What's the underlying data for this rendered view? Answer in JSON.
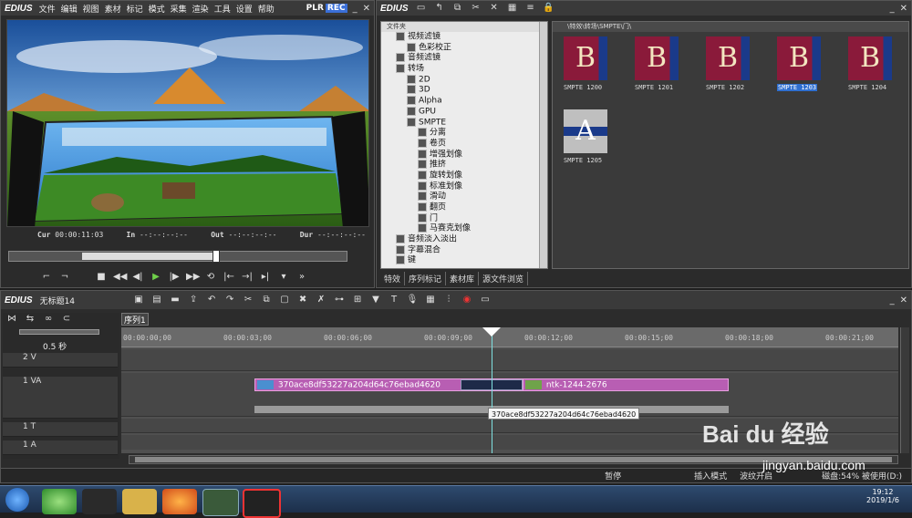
{
  "player": {
    "logo": "EDIUS",
    "menu": [
      "文件",
      "编辑",
      "视图",
      "素材",
      "标记",
      "模式",
      "采集",
      "渲染",
      "工具",
      "设置",
      "帮助"
    ],
    "plr": "PLR",
    "rec": "REC",
    "timecodes": [
      {
        "label": "Cur",
        "value": "00:00:11:03"
      },
      {
        "label": "In",
        "value": "--:--:--:--"
      },
      {
        "label": "Out",
        "value": "--:--:--:--"
      },
      {
        "label": "Dur",
        "value": "--:--:--:--"
      }
    ],
    "position": 0.61
  },
  "bin": {
    "logo": "EDIUS",
    "folder_header": "文件夹",
    "path": "\\特效\\转场\\SMPTE\\门\\",
    "tree": [
      {
        "label": "视频滤镜",
        "indent": 1
      },
      {
        "label": "色彩校正",
        "indent": 2
      },
      {
        "label": "音频滤镜",
        "indent": 1
      },
      {
        "label": "转场",
        "indent": 1
      },
      {
        "label": "2D",
        "indent": 2
      },
      {
        "label": "3D",
        "indent": 2
      },
      {
        "label": "Alpha",
        "indent": 2
      },
      {
        "label": "GPU",
        "indent": 2
      },
      {
        "label": "SMPTE",
        "indent": 2
      },
      {
        "label": "分离",
        "indent": 3
      },
      {
        "label": "卷页",
        "indent": 3
      },
      {
        "label": "增强划像",
        "indent": 3
      },
      {
        "label": "推挤",
        "indent": 3
      },
      {
        "label": "旋转划像",
        "indent": 3
      },
      {
        "label": "标准划像",
        "indent": 3
      },
      {
        "label": "滑动",
        "indent": 3
      },
      {
        "label": "翻页",
        "indent": 3
      },
      {
        "label": "门",
        "indent": 3
      },
      {
        "label": "马赛克划像",
        "indent": 3
      },
      {
        "label": "音频淡入淡出",
        "indent": 1
      },
      {
        "label": "字幕混合",
        "indent": 1
      },
      {
        "label": "键",
        "indent": 1
      }
    ],
    "items": [
      {
        "label": "SMPTE 1200",
        "letter": "B",
        "selected": false
      },
      {
        "label": "SMPTE 1201",
        "letter": "B",
        "selected": false
      },
      {
        "label": "SMPTE 1202",
        "letter": "B",
        "selected": false
      },
      {
        "label": "SMPTE 1203",
        "letter": "B",
        "selected": true
      },
      {
        "label": "SMPTE 1204",
        "letter": "B",
        "selected": false
      },
      {
        "label": "SMPTE 1205",
        "letter": "A",
        "selected": false
      }
    ],
    "tabs": [
      "特效",
      "序列标记",
      "素材库",
      "源文件浏览"
    ]
  },
  "timeline": {
    "logo": "EDIUS",
    "project": "无标题14",
    "sequence_tab": "序列1",
    "zoom": "0.5 秒",
    "ruler": [
      "00:00:00;00",
      "00:00:03;00",
      "00:00:06;00",
      "00:00:09;00",
      "00:00:12;00",
      "00:00:15;00",
      "00:00:18;00",
      "00:00:21;00"
    ],
    "tracks": [
      {
        "name": "2 V"
      },
      {
        "name": "1 VA"
      },
      {
        "name": "1 T"
      },
      {
        "name": "1 A"
      }
    ],
    "clip1": "370ace8df53227a204d64c76ebad4620",
    "clip2": "ntk-1244-2676",
    "tooltip": "370ace8df53227a204d64c76ebad4620",
    "status": [
      "暂停",
      "插入模式",
      "波纹开启",
      "磁盘:54% 被使用(D:)"
    ]
  },
  "taskbar": {
    "time": "19:12",
    "date": "2019/1/6"
  },
  "watermark": {
    "brand": "Bai du 经验",
    "url": "jingyan.baidu.com"
  },
  "colors": {
    "clip": "#b85eb3",
    "accent": "#2f6fd0",
    "rec": "#3a6fd8",
    "selected_caption": "#2f6fd0"
  }
}
